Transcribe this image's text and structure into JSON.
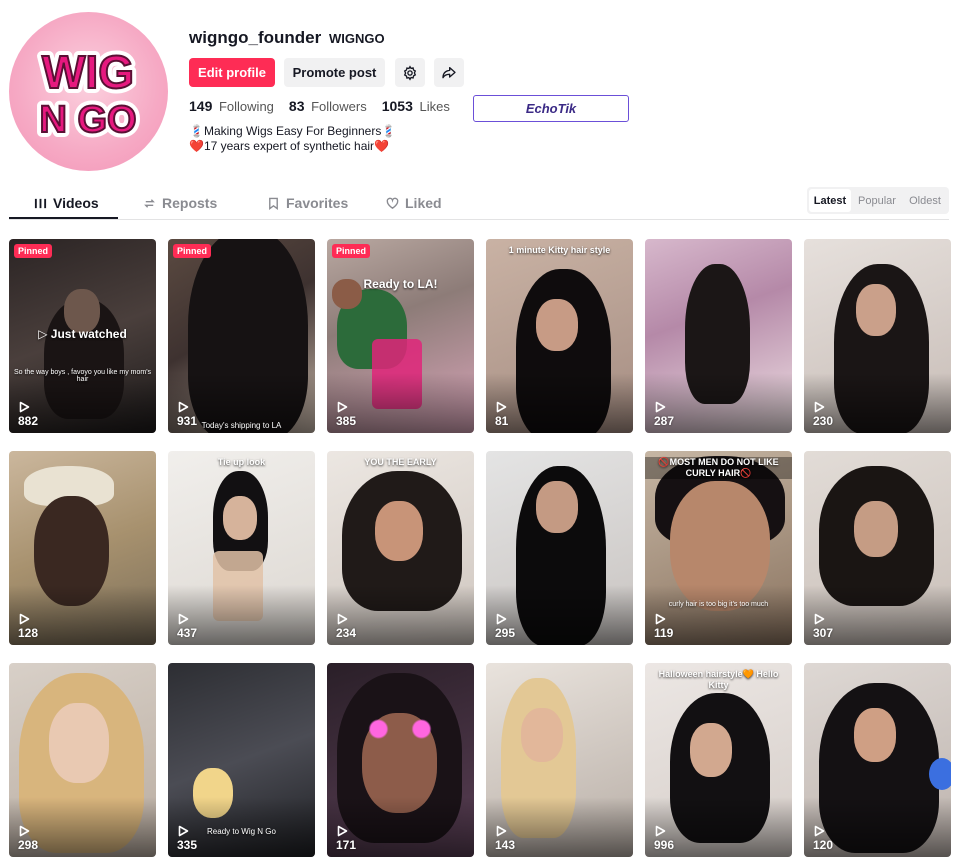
{
  "profile": {
    "username": "wigngo_founder",
    "nickname": "WIGNGO",
    "avatar_text_line1": "WIG",
    "avatar_text_line2": "N GO",
    "buttons": {
      "edit_profile": "Edit profile",
      "promote_post": "Promote post",
      "settings_icon": "gear-icon",
      "share_icon": "share-arrow-icon"
    },
    "stats": {
      "following_count": "149",
      "following_label": "Following",
      "followers_count": "83",
      "followers_label": "Followers",
      "likes_count": "1053",
      "likes_label": "Likes"
    },
    "bio_line1": "💈Making Wigs Easy For Beginners💈",
    "bio_line2": "❤️17 years expert of synthetic hair❤️",
    "extension_badge": "EchoTik"
  },
  "tabs": [
    {
      "label": "Videos",
      "icon": "grid-lines-icon",
      "active": true
    },
    {
      "label": "Reposts",
      "icon": "repost-icon",
      "active": false
    },
    {
      "label": "Favorites",
      "icon": "bookmark-icon",
      "active": false
    },
    {
      "label": "Liked",
      "icon": "heart-icon",
      "active": false
    }
  ],
  "sort": {
    "options": [
      "Latest",
      "Popular",
      "Oldest"
    ],
    "selected": "Latest"
  },
  "videos": [
    {
      "views": "882",
      "pinned": "Pinned",
      "overlay": "▷ Just watched",
      "caption": "So the way boys , favoyo you like my mom's hair",
      "bottom_caption": ""
    },
    {
      "views": "931",
      "pinned": "Pinned",
      "overlay": "",
      "caption": "",
      "bottom_caption": "Today's shipping to LA"
    },
    {
      "views": "385",
      "pinned": "Pinned",
      "overlay": "Ready to LA!",
      "caption": "",
      "bottom_caption": ""
    },
    {
      "views": "81",
      "pinned": "",
      "overlay": "1 minute Kitty hair style",
      "caption": "",
      "bottom_caption": ""
    },
    {
      "views": "287",
      "pinned": "",
      "overlay": "",
      "caption": "",
      "bottom_caption": ""
    },
    {
      "views": "230",
      "pinned": "",
      "overlay": "",
      "caption": "",
      "bottom_caption": ""
    },
    {
      "views": "128",
      "pinned": "",
      "overlay": "",
      "caption": "",
      "bottom_caption": ""
    },
    {
      "views": "437",
      "pinned": "",
      "overlay": "Tie up look",
      "caption": "",
      "bottom_caption": ""
    },
    {
      "views": "234",
      "pinned": "",
      "overlay": "YOU THE EARLY",
      "caption": "",
      "bottom_caption": ""
    },
    {
      "views": "295",
      "pinned": "",
      "overlay": "",
      "caption": "",
      "bottom_caption": ""
    },
    {
      "views": "119",
      "pinned": "",
      "overlay": "🚫MOST MEN DO NOT LIKE CURLY HAIR🚫",
      "caption": "curly hair is too big it's too much",
      "bottom_caption": ""
    },
    {
      "views": "307",
      "pinned": "",
      "overlay": "",
      "caption": "",
      "bottom_caption": ""
    },
    {
      "views": "298",
      "pinned": "",
      "overlay": "",
      "caption": "",
      "bottom_caption": ""
    },
    {
      "views": "335",
      "pinned": "",
      "overlay": "",
      "caption": "",
      "bottom_caption": "Ready to Wig N Go"
    },
    {
      "views": "171",
      "pinned": "",
      "overlay": "",
      "caption": "",
      "bottom_caption": ""
    },
    {
      "views": "143",
      "pinned": "",
      "overlay": "",
      "caption": "",
      "bottom_caption": ""
    },
    {
      "views": "996",
      "pinned": "",
      "overlay": "Halloween hairstyle🧡 Hello Kitty",
      "caption": "",
      "bottom_caption": ""
    },
    {
      "views": "120",
      "pinned": "",
      "overlay": "",
      "caption": "",
      "bottom_caption": ""
    }
  ],
  "colors": {
    "accent": "#fe2c55",
    "text": "#161823",
    "muted": "#8a8b91",
    "avatar_pink": "#f6a9c4",
    "logo_magenta": "#e6197f"
  }
}
